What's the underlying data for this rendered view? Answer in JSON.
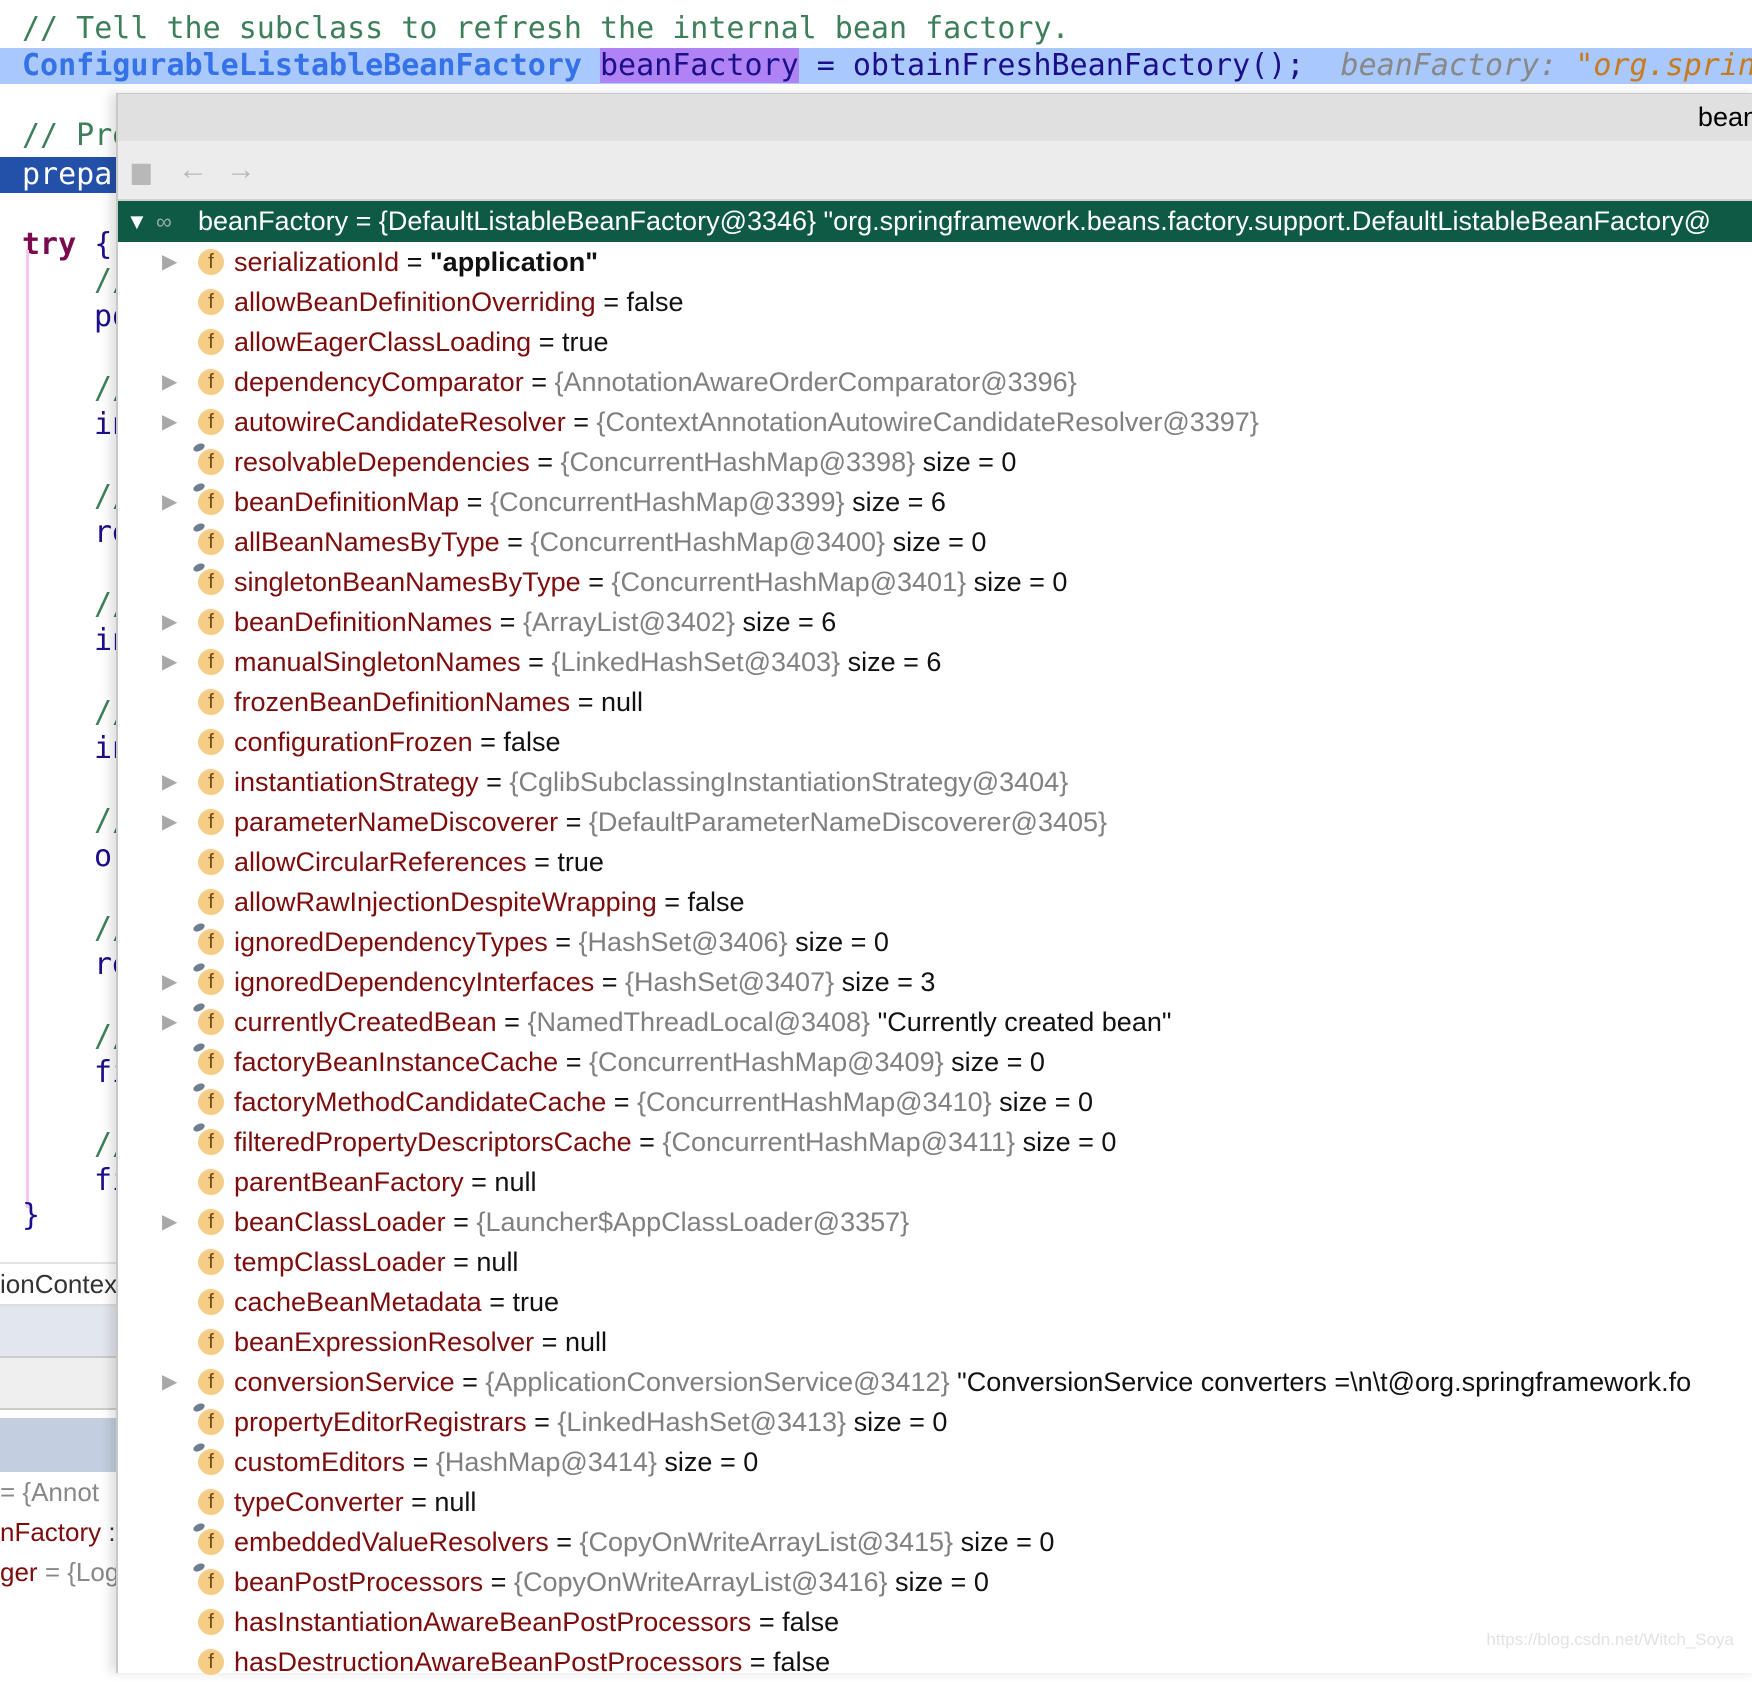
{
  "editor": {
    "comment1": "// Tell the subclass to refresh the internal bean factory.",
    "line2_type": "ConfigurableListableBeanFactory",
    "line2_var": "beanFactory",
    "line2_rest": " = obtainFreshBeanFactory();",
    "line2_inline_label": "beanFactory: ",
    "line2_inline_value": "\"org.spring",
    "comment2": "// Pre",
    "prepare": "prepa",
    "try": "try",
    "brace_open": "{",
    "brace_close": "}",
    "body_lines": [
      "//",
      "po",
      "",
      "//",
      "in",
      "",
      "//",
      "re",
      "",
      "//",
      "in",
      "",
      "//",
      "in",
      "",
      "//",
      "or",
      "",
      "//",
      "re",
      "",
      "//",
      "fi",
      "",
      "//",
      "fi"
    ]
  },
  "left_panel": {
    "context_label": "ionContex",
    "vars": [
      {
        "name": "",
        "value": "= {Annot"
      },
      {
        "name": "nFactory",
        "value": ":"
      },
      {
        "name": "ger",
        "value": "= {Log"
      }
    ]
  },
  "popup": {
    "title": "bean",
    "root": {
      "name": "beanFactory",
      "value": " = {DefaultListableBeanFactory@3346} \"org.springframework.beans.factory.support.DefaultListableBeanFactory@"
    },
    "fields": [
      {
        "name": "serializationId",
        "type": "",
        "value": "\"application\"",
        "bold": true,
        "expandable": true,
        "pin": false
      },
      {
        "name": "allowBeanDefinitionOverriding",
        "type": "",
        "value": "false",
        "expandable": false,
        "pin": false
      },
      {
        "name": "allowEagerClassLoading",
        "type": "",
        "value": "true",
        "expandable": false,
        "pin": false
      },
      {
        "name": "dependencyComparator",
        "type": "{AnnotationAwareOrderComparator@3396}",
        "value": "",
        "expandable": true,
        "pin": false
      },
      {
        "name": "autowireCandidateResolver",
        "type": "{ContextAnnotationAutowireCandidateResolver@3397}",
        "value": "",
        "expandable": true,
        "pin": false
      },
      {
        "name": "resolvableDependencies",
        "type": "{ConcurrentHashMap@3398}",
        "value": "size = 0",
        "expandable": false,
        "pin": true
      },
      {
        "name": "beanDefinitionMap",
        "type": "{ConcurrentHashMap@3399}",
        "value": "size = 6",
        "expandable": true,
        "pin": true
      },
      {
        "name": "allBeanNamesByType",
        "type": "{ConcurrentHashMap@3400}",
        "value": "size = 0",
        "expandable": false,
        "pin": true
      },
      {
        "name": "singletonBeanNamesByType",
        "type": "{ConcurrentHashMap@3401}",
        "value": "size = 0",
        "expandable": false,
        "pin": true
      },
      {
        "name": "beanDefinitionNames",
        "type": "{ArrayList@3402}",
        "value": "size = 6",
        "expandable": true,
        "pin": false
      },
      {
        "name": "manualSingletonNames",
        "type": "{LinkedHashSet@3403}",
        "value": "size = 6",
        "expandable": true,
        "pin": false
      },
      {
        "name": "frozenBeanDefinitionNames",
        "type": "",
        "value": "null",
        "expandable": false,
        "pin": false
      },
      {
        "name": "configurationFrozen",
        "type": "",
        "value": "false",
        "expandable": false,
        "pin": false
      },
      {
        "name": "instantiationStrategy",
        "type": "{CglibSubclassingInstantiationStrategy@3404}",
        "value": "",
        "expandable": true,
        "pin": false
      },
      {
        "name": "parameterNameDiscoverer",
        "type": "{DefaultParameterNameDiscoverer@3405}",
        "value": "",
        "expandable": true,
        "pin": false
      },
      {
        "name": "allowCircularReferences",
        "type": "",
        "value": "true",
        "expandable": false,
        "pin": false
      },
      {
        "name": "allowRawInjectionDespiteWrapping",
        "type": "",
        "value": "false",
        "expandable": false,
        "pin": false
      },
      {
        "name": "ignoredDependencyTypes",
        "type": "{HashSet@3406}",
        "value": "size = 0",
        "expandable": false,
        "pin": true
      },
      {
        "name": "ignoredDependencyInterfaces",
        "type": "{HashSet@3407}",
        "value": "size = 3",
        "expandable": true,
        "pin": true
      },
      {
        "name": "currentlyCreatedBean",
        "type": "{NamedThreadLocal@3408}",
        "value": "\"Currently created bean\"",
        "expandable": true,
        "pin": true
      },
      {
        "name": "factoryBeanInstanceCache",
        "type": "{ConcurrentHashMap@3409}",
        "value": "size = 0",
        "expandable": false,
        "pin": true
      },
      {
        "name": "factoryMethodCandidateCache",
        "type": "{ConcurrentHashMap@3410}",
        "value": "size = 0",
        "expandable": false,
        "pin": true
      },
      {
        "name": "filteredPropertyDescriptorsCache",
        "type": "{ConcurrentHashMap@3411}",
        "value": "size = 0",
        "expandable": false,
        "pin": true
      },
      {
        "name": "parentBeanFactory",
        "type": "",
        "value": "null",
        "expandable": false,
        "pin": false
      },
      {
        "name": "beanClassLoader",
        "type": "{Launcher$AppClassLoader@3357}",
        "value": "",
        "expandable": true,
        "pin": false
      },
      {
        "name": "tempClassLoader",
        "type": "",
        "value": "null",
        "expandable": false,
        "pin": false
      },
      {
        "name": "cacheBeanMetadata",
        "type": "",
        "value": "true",
        "expandable": false,
        "pin": false
      },
      {
        "name": "beanExpressionResolver",
        "type": "",
        "value": "null",
        "expandable": false,
        "pin": false
      },
      {
        "name": "conversionService",
        "type": "{ApplicationConversionService@3412}",
        "value": "\"ConversionService converters =\\n\\t@org.springframework.fo",
        "expandable": true,
        "pin": false
      },
      {
        "name": "propertyEditorRegistrars",
        "type": "{LinkedHashSet@3413}",
        "value": "size = 0",
        "expandable": false,
        "pin": true
      },
      {
        "name": "customEditors",
        "type": "{HashMap@3414}",
        "value": "size = 0",
        "expandable": false,
        "pin": true
      },
      {
        "name": "typeConverter",
        "type": "",
        "value": "null",
        "expandable": false,
        "pin": false
      },
      {
        "name": "embeddedValueResolvers",
        "type": "{CopyOnWriteArrayList@3415}",
        "value": "size = 0",
        "expandable": false,
        "pin": true
      },
      {
        "name": "beanPostProcessors",
        "type": "{CopyOnWriteArrayList@3416}",
        "value": "size = 0",
        "expandable": false,
        "pin": true
      },
      {
        "name": "hasInstantiationAwareBeanPostProcessors",
        "type": "",
        "value": "false",
        "expandable": false,
        "pin": false
      },
      {
        "name": "hasDestructionAwareBeanPostProcessors",
        "type": "",
        "value": "false",
        "expandable": false,
        "pin": false
      }
    ]
  },
  "watermark": "https://blog.csdn.net/Witch_Soya",
  "colors": {
    "root_bg": "#0e5a45",
    "line_highlight": "#a9c8fb",
    "var_highlight": "#b083f5",
    "field_name": "#7d0c0c",
    "field_icon": "#f6cd87"
  }
}
